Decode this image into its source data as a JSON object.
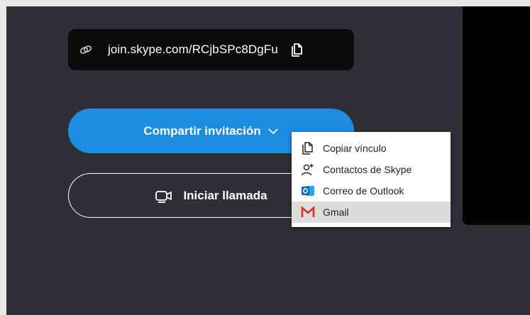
{
  "meeting": {
    "link_text": "join.skype.com/RCjbSPc8DgFu"
  },
  "buttons": {
    "share_label": "Compartir invitación",
    "call_label": "Iniciar llamada"
  },
  "share_menu": {
    "items": [
      {
        "label": "Copiar vínculo",
        "icon": "copy-icon"
      },
      {
        "label": "Contactos de Skype",
        "icon": "add-contact-icon"
      },
      {
        "label": "Correo de Outlook",
        "icon": "outlook-icon"
      },
      {
        "label": "Gmail",
        "icon": "gmail-icon"
      }
    ],
    "hovered_item": "Gmail"
  },
  "colors": {
    "background": "#2f3037",
    "accent": "#1e8ce0",
    "outlook": "#0a64c9",
    "gmail": "#d93025"
  }
}
